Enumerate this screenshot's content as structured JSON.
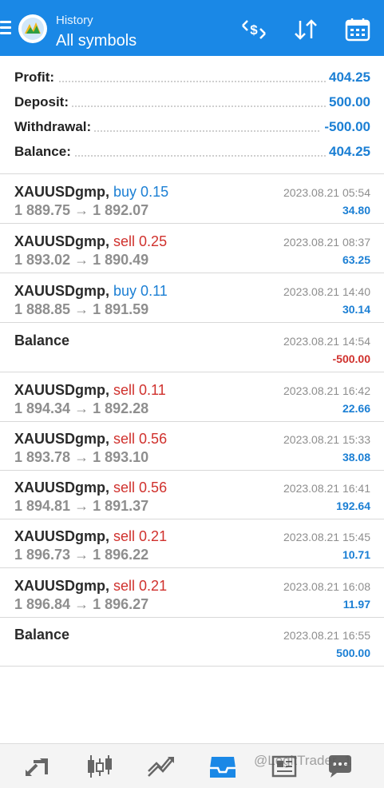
{
  "header": {
    "subtitle": "History",
    "title": "All symbols"
  },
  "summary": [
    {
      "label": "Profit:",
      "value": "404.25"
    },
    {
      "label": "Deposit:",
      "value": "500.00"
    },
    {
      "label": "Withdrawal:",
      "value": "-500.00"
    },
    {
      "label": "Balance:",
      "value": "404.25"
    }
  ],
  "deals": [
    {
      "symbol": "XAUUSDgmp,",
      "side": "buy 0.15",
      "prices": "1 889.75 → 1 892.07",
      "date": "2023.08.21 05:54",
      "profit": "34.80"
    },
    {
      "symbol": "XAUUSDgmp,",
      "side": "sell 0.25",
      "prices": "1 893.02 → 1 890.49",
      "date": "2023.08.21 08:37",
      "profit": "63.25"
    },
    {
      "symbol": "XAUUSDgmp,",
      "side": "buy 0.11",
      "prices": "1 888.85 → 1 891.59",
      "date": "2023.08.21 14:40",
      "profit": "30.14"
    },
    {
      "symbol": "Balance",
      "side": "",
      "prices": "",
      "date": "2023.08.21 14:54",
      "profit": "-500.00"
    },
    {
      "symbol": "XAUUSDgmp,",
      "side": "sell 0.11",
      "prices": "1 894.34 → 1 892.28",
      "date": "2023.08.21 16:42",
      "profit": "22.66"
    },
    {
      "symbol": "XAUUSDgmp,",
      "side": "sell 0.56",
      "prices": "1 893.78 → 1 893.10",
      "date": "2023.08.21 15:33",
      "profit": "38.08"
    },
    {
      "symbol": "XAUUSDgmp,",
      "side": "sell 0.56",
      "prices": "1 894.81 → 1 891.37",
      "date": "2023.08.21 16:41",
      "profit": "192.64"
    },
    {
      "symbol": "XAUUSDgmp,",
      "side": "sell 0.21",
      "prices": "1 896.73 → 1 896.22",
      "date": "2023.08.21 15:45",
      "profit": "10.71"
    },
    {
      "symbol": "XAUUSDgmp,",
      "side": "sell 0.21",
      "prices": "1 896.84 → 1 896.27",
      "date": "2023.08.21 16:08",
      "profit": "11.97"
    },
    {
      "symbol": "Balance",
      "side": "",
      "prices": "",
      "date": "2023.08.21 16:55",
      "profit": "500.00"
    }
  ],
  "watermark": "@LegitTrader_1",
  "colors": {
    "header": "#1a88e6",
    "buy": "#1b7fd4",
    "sell": "#d0312d",
    "profit": "#1b7fd4"
  },
  "icons": {
    "header": [
      "currency-exchange-icon",
      "sort-icon",
      "calendar-icon"
    ],
    "bottom_tabs": [
      "quotes-icon",
      "chart-icon",
      "trade-icon",
      "history-icon",
      "news-icon",
      "chat-icon"
    ]
  }
}
